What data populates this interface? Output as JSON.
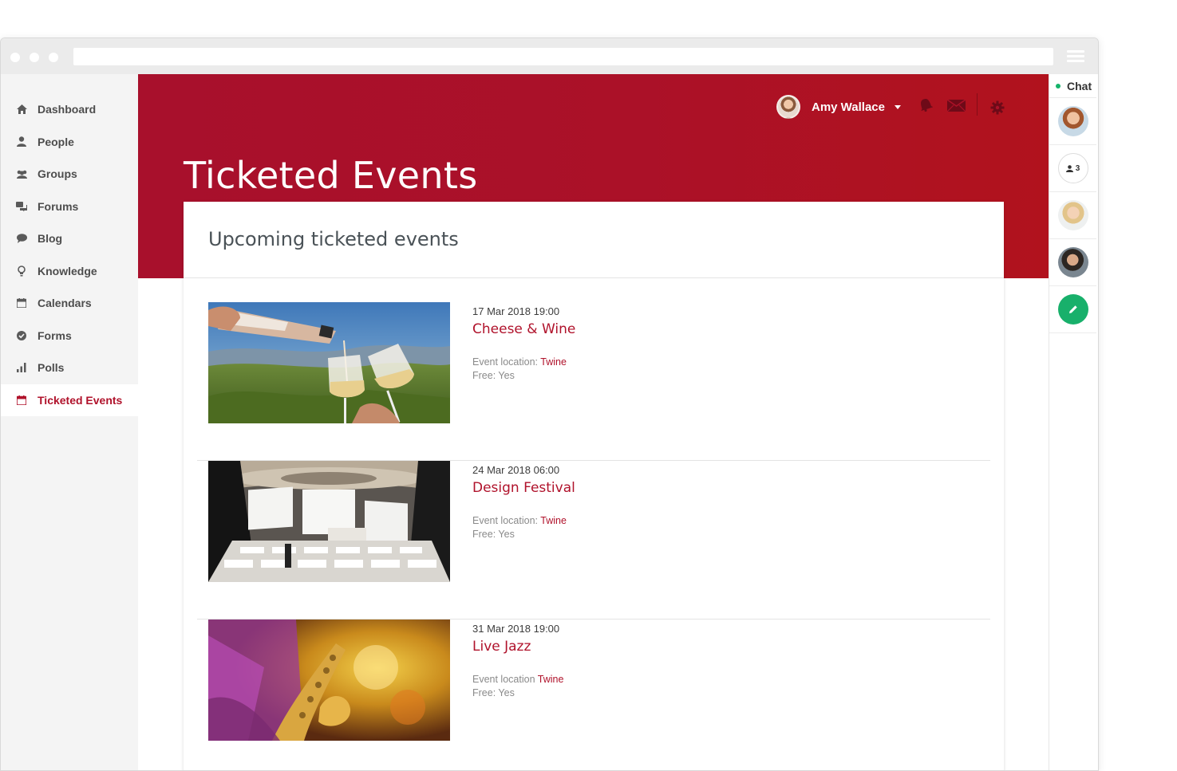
{
  "sidebar": {
    "items": [
      {
        "label": "Dashboard",
        "icon": "home-icon"
      },
      {
        "label": "People",
        "icon": "person-icon"
      },
      {
        "label": "Groups",
        "icon": "group-icon"
      },
      {
        "label": "Forums",
        "icon": "forum-icon"
      },
      {
        "label": "Blog",
        "icon": "speech-bubble-icon"
      },
      {
        "label": "Knowledge",
        "icon": "lightbulb-icon"
      },
      {
        "label": "Calendars",
        "icon": "calendar-icon"
      },
      {
        "label": "Forms",
        "icon": "check-circle-icon"
      },
      {
        "label": "Polls",
        "icon": "bar-chart-icon"
      },
      {
        "label": "Ticketed Events",
        "icon": "calendar-icon",
        "active": true
      }
    ]
  },
  "header": {
    "user_name": "Amy Wallace",
    "page_title": "Ticketed Events"
  },
  "main": {
    "section_title": "Upcoming ticketed events",
    "events": [
      {
        "date": "17 Mar 2018 19:00",
        "title": "Cheese & Wine",
        "location_label": "Event location:",
        "location": "Twine",
        "free": "Free: Yes"
      },
      {
        "date": "24 Mar 2018 06:00",
        "title": "Design Festival",
        "location_label": "Event location:",
        "location": "Twine",
        "free": "Free: Yes"
      },
      {
        "date": "31 Mar 2018 19:00",
        "title": "Live Jazz",
        "location_label": "Event location",
        "location": "Twine",
        "free": "Free: Yes"
      }
    ]
  },
  "chat": {
    "label": "Chat",
    "group_count": "3"
  },
  "colors": {
    "brand": "#b0122b",
    "online": "#15b36a",
    "compose": "#18b06b"
  }
}
